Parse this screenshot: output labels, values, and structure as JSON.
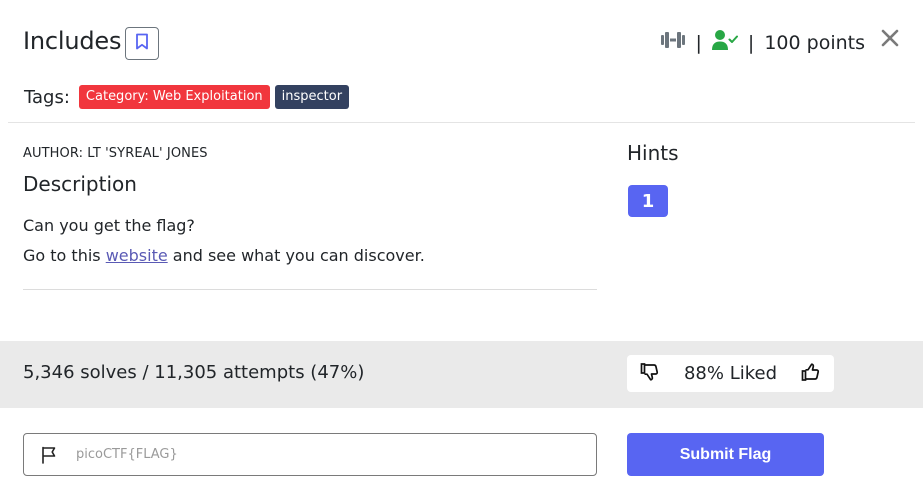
{
  "challenge": {
    "title": "Includes",
    "points": "100 points",
    "separator": "|"
  },
  "tags": {
    "label": "Tags:",
    "items": [
      {
        "text": "Category: Web Exploitation",
        "color": "#f1363d"
      },
      {
        "text": "inspector",
        "color": "#334160"
      }
    ]
  },
  "description": {
    "author": "AUTHOR: LT 'SYREAL' JONES",
    "heading": "Description",
    "line1": "Can you get the flag?",
    "line2_before": "Go to this ",
    "line2_link": "website",
    "line2_after": " and see what you can discover."
  },
  "hints": {
    "heading": "Hints",
    "items": [
      "1"
    ]
  },
  "stats": {
    "solves_text": "5,346 solves / 11,305 attempts (47%)",
    "liked_text": "88% Liked"
  },
  "flag_form": {
    "placeholder": "picoCTF{FLAG}",
    "value": "",
    "submit_label": "Submit Flag"
  },
  "icons": {
    "bookmark": "bookmark-icon",
    "difficulty": "difficulty-bars-icon",
    "solved_user": "user-check-icon",
    "close": "close-icon",
    "thumbs_down": "thumbs-down-icon",
    "thumbs_up": "thumbs-up-icon",
    "flag": "flag-icon"
  },
  "colors": {
    "accent": "#5865f2",
    "tag_category": "#f1363d",
    "tag_dark": "#334160",
    "solved_green": "#28a745",
    "link": "#5a5ab5",
    "stats_bg": "#eaeaea"
  }
}
